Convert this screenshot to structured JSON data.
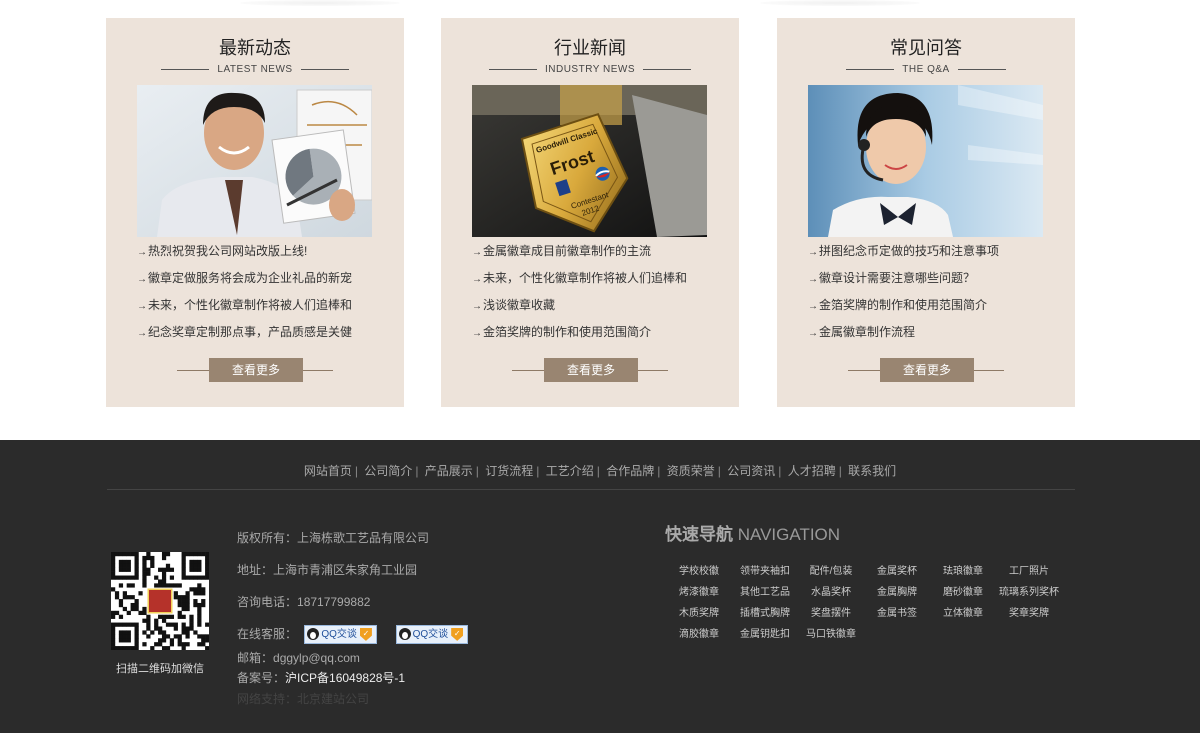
{
  "columns": [
    {
      "title": "最新动态",
      "subtitle": "LATEST NEWS",
      "items": [
        "热烈祝贺我公司网站改版上线!",
        "徽章定做服务将会成为企业礼品的新宠",
        "未来，个性化徽章制作将被人们追棒和",
        "纪念奖章定制那点事，产品质感是关健"
      ],
      "more": "查看更多"
    },
    {
      "title": "行业新闻",
      "subtitle": "INDUSTRY NEWS",
      "items": [
        "金属徽章成目前徽章制作的主流",
        "未来，个性化徽章制作将被人们追棒和",
        "浅谈徽章收藏",
        "金箔奖牌的制作和使用范围简介"
      ],
      "more": "查看更多"
    },
    {
      "title": "常见问答",
      "subtitle": "THE Q&A",
      "items": [
        "拼图纪念币定做的技巧和注意事项",
        "徽章设计需要注意哪些问题？",
        "金箔奖牌的制作和使用范围简介",
        "金属徽章制作流程"
      ],
      "more": "查看更多"
    }
  ],
  "badge_image": {
    "line1": "Goodwill Classic",
    "brand": "Frost",
    "line3": "Contestant",
    "year": "2012"
  },
  "footer": {
    "nav": [
      "网站首页",
      "公司简介",
      "产品展示",
      "订货流程",
      "工艺介绍",
      "合作品牌",
      "资质荣誉",
      "公司资讯",
      "人才招聘",
      "联系我们"
    ],
    "qr_caption": "扫描二维码加微信",
    "copyright_label": "版权所有：",
    "copyright_value": "上海栋歌工艺品有限公司",
    "address_label": "地址：",
    "address_value": "上海市青浦区朱家角工业园",
    "phone_label": "咨询电话：",
    "phone_value": "18717799882",
    "service_label": "在线客服：",
    "qq_label": "QQ交谈",
    "email_label": "邮箱：",
    "email_value": "dggylp@qq.com",
    "icp_label": "备案号：",
    "icp_value": "沪ICP备16049828号-1",
    "support_text": "网络支持：北京建站公司",
    "quick_title_cn": "快速导航",
    "quick_title_en": "NAVIGATION",
    "quick_links": [
      [
        "学校校徽",
        "领带夹袖扣",
        "配件/包装",
        "金属奖杯",
        "珐琅徽章",
        "工厂照片"
      ],
      [
        "烤漆徽章",
        "其他工艺品",
        "水晶奖杯",
        "金属胸牌",
        "磨砂徽章",
        "琉璃系列奖杯"
      ],
      [
        "木质奖牌",
        "插槽式胸牌",
        "奖盘摆件",
        "金属书签",
        "立体徽章",
        "奖章奖牌"
      ],
      [
        "滴胶徽章",
        "金属钥匙扣",
        "马口铁徽章"
      ]
    ]
  }
}
